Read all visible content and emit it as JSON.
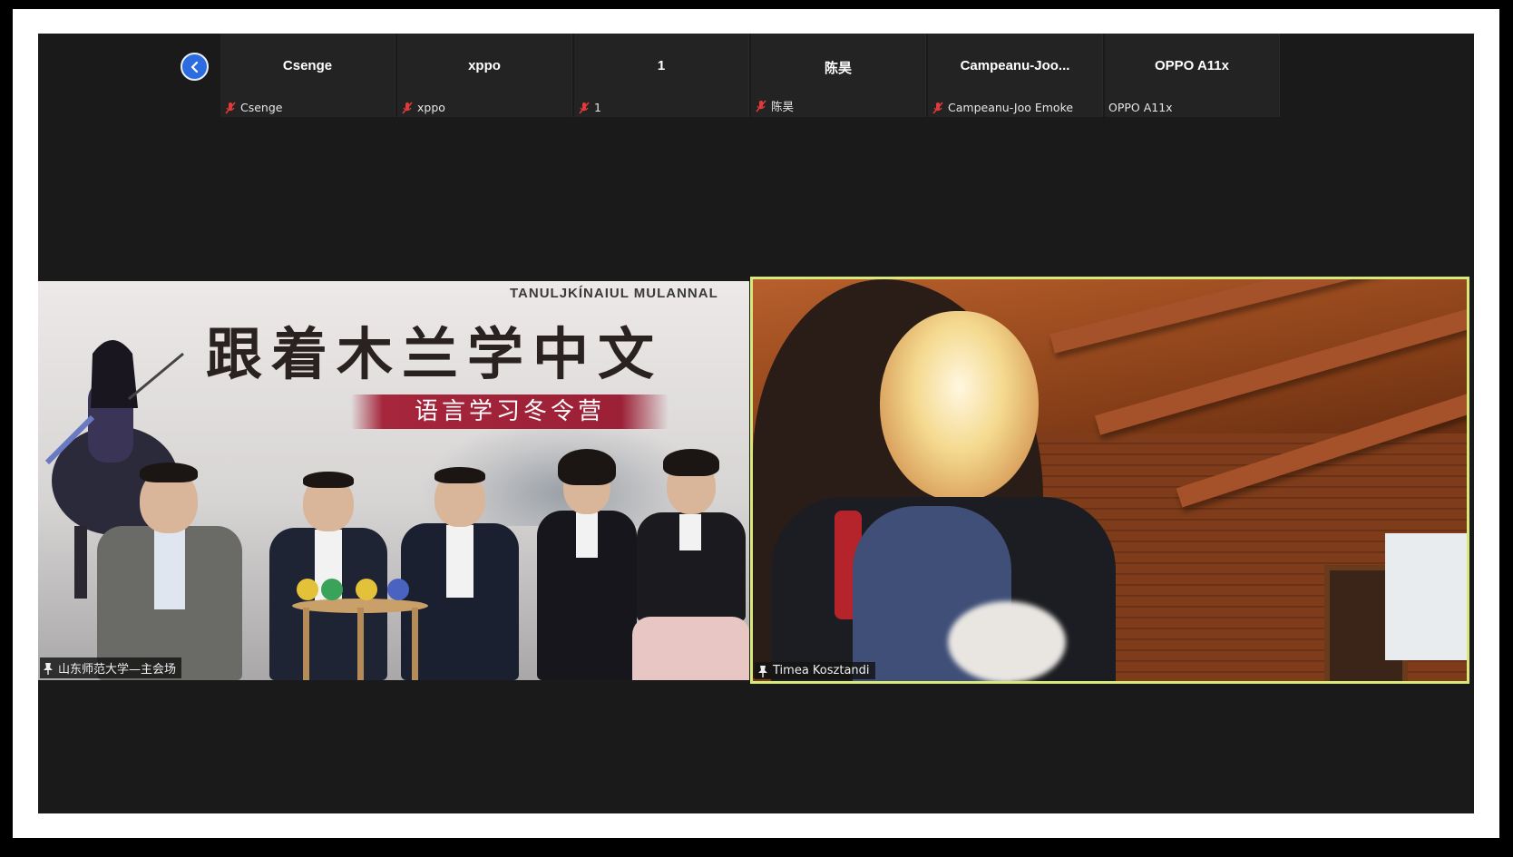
{
  "participants": [
    {
      "tile_name": "Csenge",
      "label": "Csenge",
      "muted": true
    },
    {
      "tile_name": "xppo",
      "label": "xppo",
      "muted": true
    },
    {
      "tile_name": "1",
      "label": "1",
      "muted": true
    },
    {
      "tile_name": "陈昊",
      "label": "陈昊",
      "muted": true
    },
    {
      "tile_name": "Campeanu-Joo...",
      "label": "Campeanu-Joo Emoke",
      "muted": true
    },
    {
      "tile_name": "OPPO A11x",
      "label": "OPPO A11x",
      "muted": false
    }
  ],
  "main_videos": [
    {
      "label": "山东师范大学—主会场",
      "pinned": true
    },
    {
      "label": "Timea Kosztandi",
      "pinned": true,
      "active_speaker": true
    }
  ],
  "banner": {
    "title": "跟着木兰学中文",
    "subtitle": "语言学习冬令营",
    "caption": "TANULJKÍNAIUL MULANNAL"
  },
  "colors": {
    "app_bg": "#1a1a1a",
    "tile_bg": "#232323",
    "back_button": "#2d6cdf",
    "muted_icon": "#e03a3a",
    "active_speaker_border": "#d8e87a"
  },
  "icons": {
    "back": "chevron-left-icon",
    "muted": "mic-muted-icon",
    "pin": "pin-icon"
  }
}
